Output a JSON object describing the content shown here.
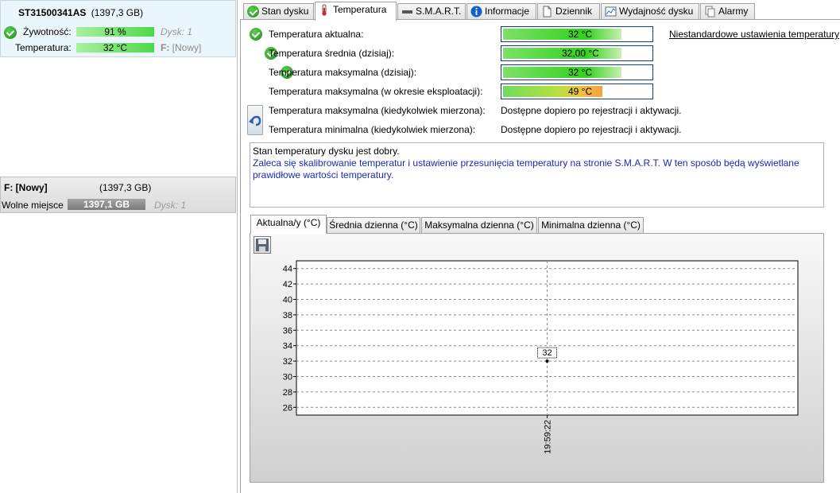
{
  "disk": {
    "name": "ST31500341AS",
    "size": "(1397,3 GB)",
    "health_label": "Żywotność:",
    "health_value": "91 %",
    "health_disk": "Dysk: 1",
    "temp_label": "Temperatura:",
    "temp_value": "32 °C",
    "temp_part": "F:",
    "temp_part_name": "[Nowy]"
  },
  "partition": {
    "name": "F: [Nowy]",
    "size": "(1397,3 GB)",
    "free_label": "Wolne miejsce",
    "free_value": "1397,1 GB",
    "disk_ref": "Dysk: 1"
  },
  "tabs": [
    {
      "label": "Stan dysku",
      "icon": "check-circle-icon"
    },
    {
      "label": "Temperatura",
      "icon": "thermometer-icon"
    },
    {
      "label": "S.M.A.R.T.",
      "icon": "disk-drive-icon"
    },
    {
      "label": "Informacje",
      "icon": "info-icon"
    },
    {
      "label": "Dziennik",
      "icon": "document-icon"
    },
    {
      "label": "Wydajność dysku",
      "icon": "performance-chart-icon"
    },
    {
      "label": "Alarmy",
      "icon": "alarm-pages-icon"
    }
  ],
  "temperature": {
    "custom_settings_link": "Niestandardowe ustawienia temperatury",
    "rows": [
      {
        "label": "Temperatura aktualna:",
        "value": "32 °C",
        "level": 0.8,
        "ok": true
      },
      {
        "label": "Temperatura średnia (dzisiaj):",
        "value": "32,00 °C",
        "level": 0.8,
        "ok": true
      },
      {
        "label": "Temperatura maksymalna (dzisiaj):",
        "value": "32 °C",
        "level": 0.8,
        "ok": true
      },
      {
        "label": "Temperatura maksymalna (w okresie eksploatacji):",
        "value": "49 °C",
        "level": 0.67,
        "ok": false
      }
    ],
    "info_rows": [
      {
        "label": "Temperatura maksymalna (kiedykolwiek mierzona):",
        "value": "Dostępne dopiero po rejestracji i aktywacji."
      },
      {
        "label": "Temperatura minimalna (kiedykolwiek mierzona):",
        "value": "Dostępne dopiero po rejestracji i aktywacji."
      }
    ],
    "status_msg": "Stan temperatury dysku jest dobry.",
    "calibration_msg": "Zaleca się skalibrowanie temperatur i ustawienie przesunięcia temperatury na stronie S.M.A.R.T. W ten sposób będą wyświetlane prawidłowe wartości temperatury."
  },
  "chart_tabs": [
    "Aktualna/y (°C)",
    "Średnia dzienna (°C)",
    "Maksymalna dzienna (°C)",
    "Minimalna dzienna (°C)"
  ],
  "chart_data": {
    "type": "scatter",
    "x": [
      "19:59:22"
    ],
    "y": [
      32
    ],
    "data_labels": [
      "32"
    ],
    "ylim": [
      25,
      45
    ],
    "yticks": [
      26,
      28,
      30,
      32,
      34,
      36,
      38,
      40,
      42,
      44
    ],
    "grid": true
  },
  "colors": {
    "accent_blue": "#1a2ab8",
    "ok_green": "#1f8a1a"
  }
}
